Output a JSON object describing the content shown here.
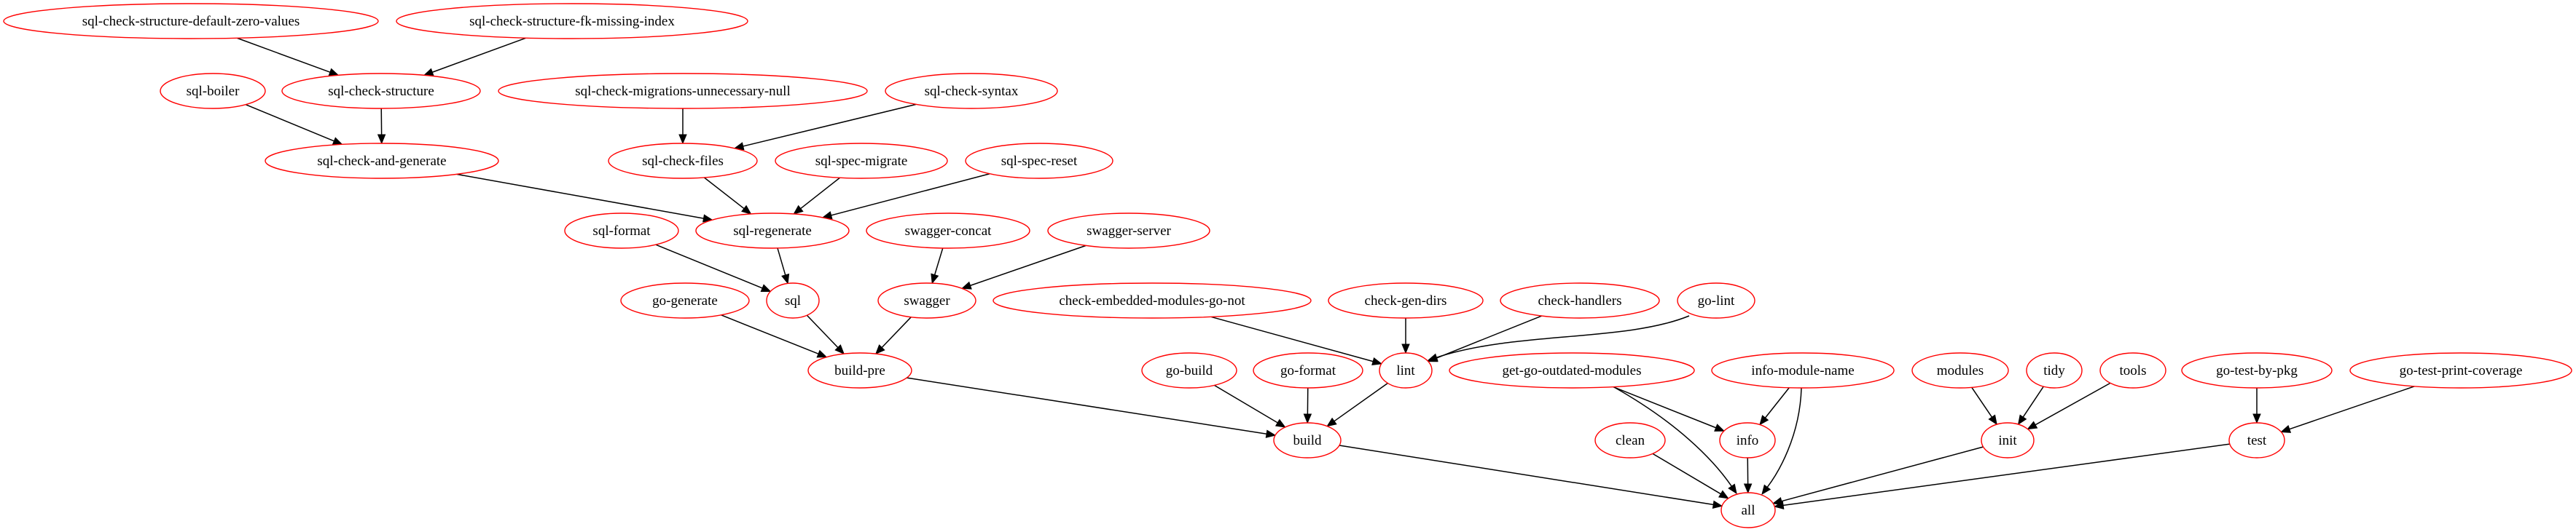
{
  "graph": {
    "type": "directed-dependency-graph",
    "node_color": "#ff0000",
    "edge_color": "#000000",
    "nodes": [
      {
        "id": "sql-check-structure-default-zero-values",
        "label": "sql-check-structure-default-zero-values"
      },
      {
        "id": "sql-check-structure-fk-missing-index",
        "label": "sql-check-structure-fk-missing-index"
      },
      {
        "id": "sql-boiler",
        "label": "sql-boiler"
      },
      {
        "id": "sql-check-structure",
        "label": "sql-check-structure"
      },
      {
        "id": "sql-check-migrations-unnecessary-null",
        "label": "sql-check-migrations-unnecessary-null"
      },
      {
        "id": "sql-check-syntax",
        "label": "sql-check-syntax"
      },
      {
        "id": "sql-check-and-generate",
        "label": "sql-check-and-generate"
      },
      {
        "id": "sql-check-files",
        "label": "sql-check-files"
      },
      {
        "id": "sql-spec-migrate",
        "label": "sql-spec-migrate"
      },
      {
        "id": "sql-spec-reset",
        "label": "sql-spec-reset"
      },
      {
        "id": "sql-format",
        "label": "sql-format"
      },
      {
        "id": "sql-regenerate",
        "label": "sql-regenerate"
      },
      {
        "id": "swagger-concat",
        "label": "swagger-concat"
      },
      {
        "id": "swagger-server",
        "label": "swagger-server"
      },
      {
        "id": "go-generate",
        "label": "go-generate"
      },
      {
        "id": "sql",
        "label": "sql"
      },
      {
        "id": "swagger",
        "label": "swagger"
      },
      {
        "id": "check-embedded-modules-go-not",
        "label": "check-embedded-modules-go-not"
      },
      {
        "id": "check-gen-dirs",
        "label": "check-gen-dirs"
      },
      {
        "id": "check-handlers",
        "label": "check-handlers"
      },
      {
        "id": "go-lint",
        "label": "go-lint"
      },
      {
        "id": "build-pre",
        "label": "build-pre"
      },
      {
        "id": "go-build",
        "label": "go-build"
      },
      {
        "id": "go-format",
        "label": "go-format"
      },
      {
        "id": "lint",
        "label": "lint"
      },
      {
        "id": "get-go-outdated-modules",
        "label": "get-go-outdated-modules"
      },
      {
        "id": "info-module-name",
        "label": "info-module-name"
      },
      {
        "id": "modules",
        "label": "modules"
      },
      {
        "id": "tidy",
        "label": "tidy"
      },
      {
        "id": "tools",
        "label": "tools"
      },
      {
        "id": "go-test-by-pkg",
        "label": "go-test-by-pkg"
      },
      {
        "id": "go-test-print-coverage",
        "label": "go-test-print-coverage"
      },
      {
        "id": "build",
        "label": "build"
      },
      {
        "id": "clean",
        "label": "clean"
      },
      {
        "id": "info",
        "label": "info"
      },
      {
        "id": "init",
        "label": "init"
      },
      {
        "id": "test",
        "label": "test"
      },
      {
        "id": "all",
        "label": "all"
      }
    ],
    "edges": [
      [
        "sql-check-structure-default-zero-values",
        "sql-check-structure"
      ],
      [
        "sql-check-structure-fk-missing-index",
        "sql-check-structure"
      ],
      [
        "sql-boiler",
        "sql-check-and-generate"
      ],
      [
        "sql-check-structure",
        "sql-check-and-generate"
      ],
      [
        "sql-check-migrations-unnecessary-null",
        "sql-check-files"
      ],
      [
        "sql-check-syntax",
        "sql-check-files"
      ],
      [
        "sql-check-and-generate",
        "sql-regenerate"
      ],
      [
        "sql-check-files",
        "sql-regenerate"
      ],
      [
        "sql-spec-migrate",
        "sql-regenerate"
      ],
      [
        "sql-spec-reset",
        "sql-regenerate"
      ],
      [
        "sql-format",
        "sql"
      ],
      [
        "sql-regenerate",
        "sql"
      ],
      [
        "swagger-concat",
        "swagger"
      ],
      [
        "swagger-server",
        "swagger"
      ],
      [
        "go-generate",
        "build-pre"
      ],
      [
        "sql",
        "build-pre"
      ],
      [
        "swagger",
        "build-pre"
      ],
      [
        "check-embedded-modules-go-not",
        "lint"
      ],
      [
        "check-gen-dirs",
        "lint"
      ],
      [
        "check-handlers",
        "lint"
      ],
      [
        "go-lint",
        "lint"
      ],
      [
        "build-pre",
        "build"
      ],
      [
        "go-build",
        "build"
      ],
      [
        "go-format",
        "build"
      ],
      [
        "lint",
        "build"
      ],
      [
        "get-go-outdated-modules",
        "info"
      ],
      [
        "get-go-outdated-modules",
        "all"
      ],
      [
        "info-module-name",
        "info"
      ],
      [
        "info-module-name",
        "all"
      ],
      [
        "modules",
        "init"
      ],
      [
        "tidy",
        "init"
      ],
      [
        "tools",
        "init"
      ],
      [
        "go-test-by-pkg",
        "test"
      ],
      [
        "go-test-print-coverage",
        "test"
      ],
      [
        "build",
        "all"
      ],
      [
        "clean",
        "all"
      ],
      [
        "info",
        "all"
      ],
      [
        "init",
        "all"
      ],
      [
        "test",
        "all"
      ]
    ]
  }
}
